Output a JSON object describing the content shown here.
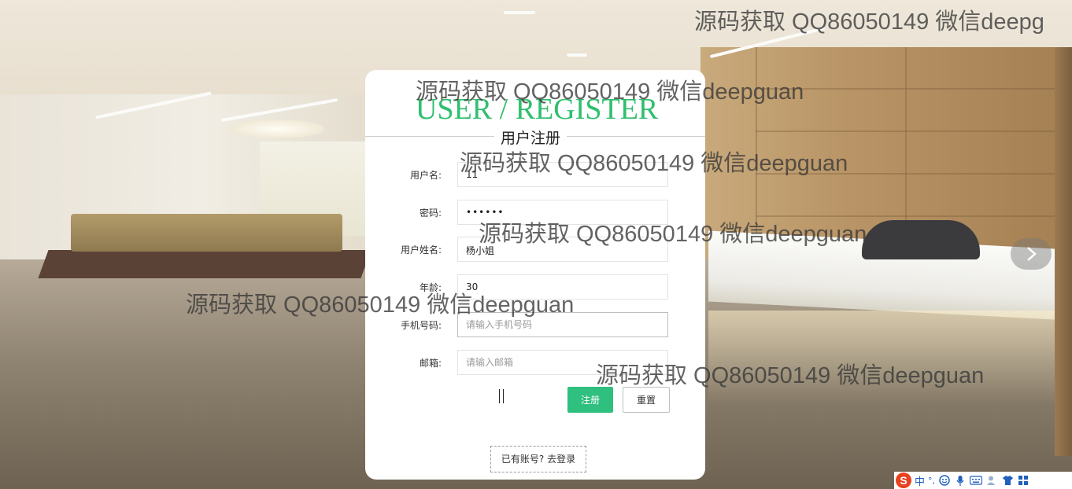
{
  "watermark": "源码获取 QQ86050149 微信deepguan",
  "watermark_top": "源码获取 QQ86050149 微信deepg",
  "card": {
    "brand": "USER / REGISTER",
    "subtitle": "用户注册"
  },
  "form": {
    "username": {
      "label": "用户名:",
      "value": "11"
    },
    "password": {
      "label": "密码:",
      "value": "••••••"
    },
    "realname": {
      "label": "用户姓名:",
      "value": "杨小姐"
    },
    "age": {
      "label": "年龄:",
      "value": "30"
    },
    "phone": {
      "label": "手机号码:",
      "placeholder": "请输入手机号码"
    },
    "email": {
      "label": "邮箱:",
      "placeholder": "请输入邮箱"
    }
  },
  "buttons": {
    "submit": "注册",
    "reset": "重置"
  },
  "login_link": "已有账号? 去登录",
  "ime": {
    "logo": "S",
    "mode": "中",
    "punct": "°,"
  },
  "icons": [
    "next-arrow-icon",
    "smiley-icon",
    "microphone-icon",
    "keyboard-icon",
    "user-icon",
    "shirt-icon",
    "grid-icon"
  ]
}
